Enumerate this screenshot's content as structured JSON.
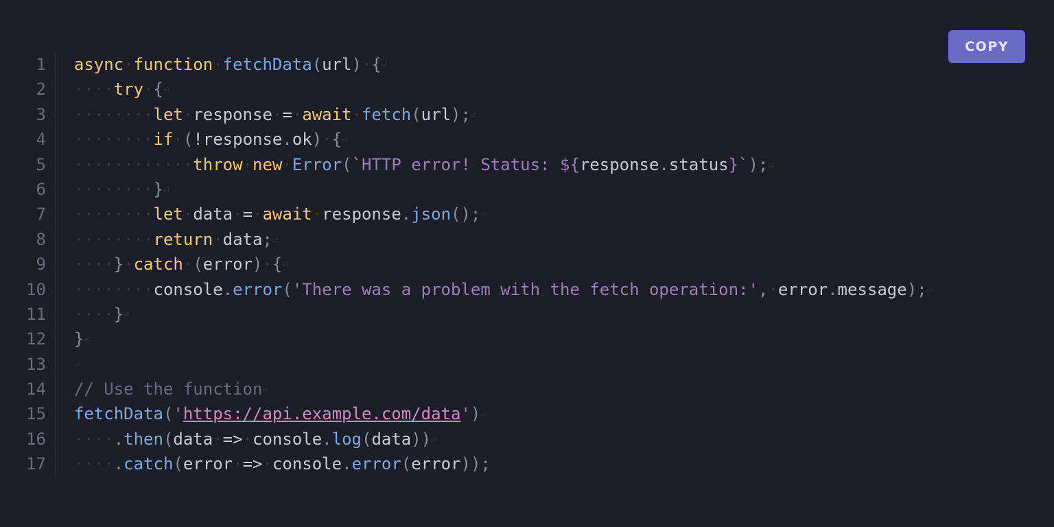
{
  "copy_button": {
    "label": "COPY"
  },
  "line_numbers": [
    "1",
    "2",
    "3",
    "4",
    "5",
    "6",
    "7",
    "8",
    "9",
    "10",
    "11",
    "12",
    "13",
    "14",
    "15",
    "16",
    "17"
  ],
  "code_lines": [
    {
      "indent": 0,
      "tokens": [
        [
          "kw",
          "async"
        ],
        [
          "ws",
          " "
        ],
        [
          "kw",
          "function"
        ],
        [
          "ws",
          " "
        ],
        [
          "fn",
          "fetchData"
        ],
        [
          "pn",
          "("
        ],
        [
          "id",
          "url"
        ],
        [
          "pn",
          ")"
        ],
        [
          "ws",
          " "
        ],
        [
          "pn",
          "{"
        ]
      ],
      "lf": true
    },
    {
      "indent": 4,
      "tokens": [
        [
          "kw",
          "try"
        ],
        [
          "ws",
          " "
        ],
        [
          "pn",
          "{"
        ]
      ],
      "lf": true
    },
    {
      "indent": 8,
      "tokens": [
        [
          "kw",
          "let"
        ],
        [
          "ws",
          " "
        ],
        [
          "id",
          "response"
        ],
        [
          "ws",
          " "
        ],
        [
          "op",
          "="
        ],
        [
          "ws",
          " "
        ],
        [
          "kw",
          "await"
        ],
        [
          "ws",
          " "
        ],
        [
          "fn",
          "fetch"
        ],
        [
          "pn",
          "("
        ],
        [
          "id",
          "url"
        ],
        [
          "pn",
          ")"
        ],
        [
          "pn",
          ";"
        ]
      ],
      "lf": true
    },
    {
      "indent": 8,
      "tokens": [
        [
          "kw",
          "if"
        ],
        [
          "ws",
          " "
        ],
        [
          "pn",
          "("
        ],
        [
          "op",
          "!"
        ],
        [
          "id",
          "response"
        ],
        [
          "pn",
          "."
        ],
        [
          "id",
          "ok"
        ],
        [
          "pn",
          ")"
        ],
        [
          "ws",
          " "
        ],
        [
          "pn",
          "{"
        ]
      ],
      "lf": true
    },
    {
      "indent": 12,
      "tokens": [
        [
          "kw",
          "throw"
        ],
        [
          "ws",
          " "
        ],
        [
          "kw",
          "new"
        ],
        [
          "ws",
          " "
        ],
        [
          "fn",
          "Error"
        ],
        [
          "pn",
          "("
        ],
        [
          "st",
          "`HTTP error! Status: ${"
        ],
        [
          "id",
          "response"
        ],
        [
          "pn",
          "."
        ],
        [
          "id",
          "status"
        ],
        [
          "st",
          "}`"
        ],
        [
          "pn",
          ")"
        ],
        [
          "pn",
          ";"
        ]
      ],
      "lf": true
    },
    {
      "indent": 8,
      "tokens": [
        [
          "pn",
          "}"
        ]
      ],
      "lf": true
    },
    {
      "indent": 8,
      "tokens": [
        [
          "kw",
          "let"
        ],
        [
          "ws",
          " "
        ],
        [
          "id",
          "data"
        ],
        [
          "ws",
          " "
        ],
        [
          "op",
          "="
        ],
        [
          "ws",
          " "
        ],
        [
          "kw",
          "await"
        ],
        [
          "ws",
          " "
        ],
        [
          "id",
          "response"
        ],
        [
          "pn",
          "."
        ],
        [
          "fn",
          "json"
        ],
        [
          "pn",
          "("
        ],
        [
          "pn",
          ")"
        ],
        [
          "pn",
          ";"
        ]
      ],
      "lf": true
    },
    {
      "indent": 8,
      "tokens": [
        [
          "kw",
          "return"
        ],
        [
          "ws",
          " "
        ],
        [
          "id",
          "data"
        ],
        [
          "pn",
          ";"
        ]
      ],
      "lf": true
    },
    {
      "indent": 4,
      "tokens": [
        [
          "pn",
          "}"
        ],
        [
          "ws",
          " "
        ],
        [
          "kw",
          "catch"
        ],
        [
          "ws",
          " "
        ],
        [
          "pn",
          "("
        ],
        [
          "id",
          "error"
        ],
        [
          "pn",
          ")"
        ],
        [
          "ws",
          " "
        ],
        [
          "pn",
          "{"
        ]
      ],
      "lf": true
    },
    {
      "indent": 8,
      "tokens": [
        [
          "id",
          "console"
        ],
        [
          "pn",
          "."
        ],
        [
          "fn",
          "error"
        ],
        [
          "pn",
          "("
        ],
        [
          "st",
          "'There was a problem with the fetch operation:'"
        ],
        [
          "pn",
          ","
        ],
        [
          "ws",
          " "
        ],
        [
          "id",
          "error"
        ],
        [
          "pn",
          "."
        ],
        [
          "id",
          "message"
        ],
        [
          "pn",
          ")"
        ],
        [
          "pn",
          ";"
        ]
      ],
      "lf": true
    },
    {
      "indent": 4,
      "tokens": [
        [
          "pn",
          "}"
        ]
      ],
      "lf": true
    },
    {
      "indent": 0,
      "tokens": [
        [
          "pn",
          "}"
        ]
      ],
      "lf": true
    },
    {
      "indent": 0,
      "tokens": [],
      "lf": true
    },
    {
      "indent": 0,
      "tokens": [
        [
          "cm",
          "// Use the function"
        ]
      ],
      "lf": true
    },
    {
      "indent": 0,
      "tokens": [
        [
          "fn",
          "fetchData"
        ],
        [
          "pn",
          "("
        ],
        [
          "st",
          "'"
        ],
        [
          "lk",
          "https://api.example.com/data"
        ],
        [
          "st",
          "'"
        ],
        [
          "pn",
          ")"
        ]
      ],
      "lf": true
    },
    {
      "indent": 4,
      "tokens": [
        [
          "pn",
          "."
        ],
        [
          "fn",
          "then"
        ],
        [
          "pn",
          "("
        ],
        [
          "id",
          "data"
        ],
        [
          "ws",
          " "
        ],
        [
          "op",
          "=>"
        ],
        [
          "ws",
          " "
        ],
        [
          "id",
          "console"
        ],
        [
          "pn",
          "."
        ],
        [
          "fn",
          "log"
        ],
        [
          "pn",
          "("
        ],
        [
          "id",
          "data"
        ],
        [
          "pn",
          ")"
        ],
        [
          "pn",
          ")"
        ]
      ],
      "lf": true
    },
    {
      "indent": 4,
      "tokens": [
        [
          "pn",
          "."
        ],
        [
          "fn",
          "catch"
        ],
        [
          "pn",
          "("
        ],
        [
          "id",
          "error"
        ],
        [
          "ws",
          " "
        ],
        [
          "op",
          "=>"
        ],
        [
          "ws",
          " "
        ],
        [
          "id",
          "console"
        ],
        [
          "pn",
          "."
        ],
        [
          "fn",
          "error"
        ],
        [
          "pn",
          "("
        ],
        [
          "id",
          "error"
        ],
        [
          "pn",
          ")"
        ],
        [
          "pn",
          ")"
        ],
        [
          "pn",
          ";"
        ]
      ],
      "lf": false
    }
  ],
  "whitespace_dot": "·",
  "lf_glyph": "⏎"
}
